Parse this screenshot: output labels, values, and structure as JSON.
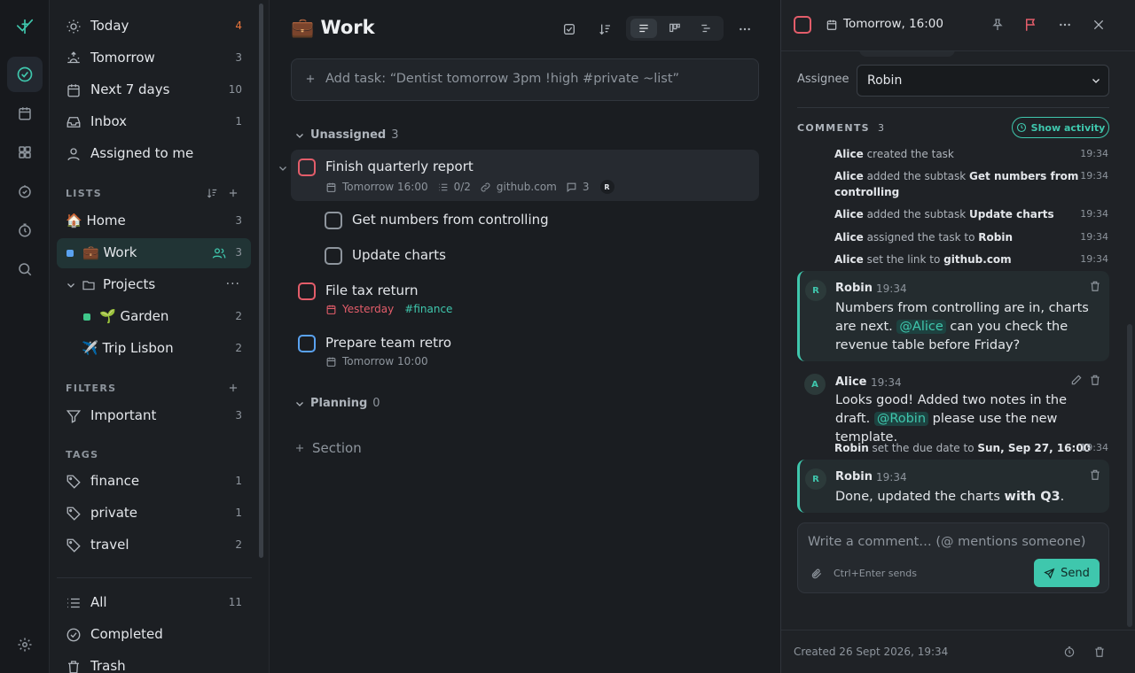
{
  "rail": {
    "items": [
      "check-circle-icon",
      "calendar-icon",
      "grid-icon",
      "compass-icon",
      "timer-icon",
      "search-icon",
      "settings-icon"
    ]
  },
  "sidebar": {
    "smart": [
      {
        "label": "Today",
        "count": "4",
        "icon": "sun-icon",
        "count_color": "#e8743b"
      },
      {
        "label": "Tomorrow",
        "count": "3",
        "icon": "sunrise-icon"
      },
      {
        "label": "Next 7 days",
        "count": "10",
        "icon": "calendar-icon"
      },
      {
        "label": "Inbox",
        "count": "1",
        "icon": "inbox-icon"
      },
      {
        "label": "Assigned to me",
        "count": "",
        "icon": "user-icon"
      }
    ],
    "lists_header": "LISTS",
    "lists": [
      {
        "label": "🏠 Home",
        "count": "3"
      },
      {
        "label": "💼 Work",
        "count": "3",
        "color": "#5aa2f0",
        "shared": true
      },
      {
        "label": "Projects",
        "count": ""
      },
      {
        "label": "🌱 Garden",
        "count": "2",
        "color": "#3fc78a"
      },
      {
        "label": "✈️ Trip Lisbon",
        "count": "2"
      }
    ],
    "filters_header": "FILTERS",
    "filters": [
      {
        "label": "Important",
        "count": "3"
      }
    ],
    "tags_header": "TAGS",
    "tags": [
      {
        "label": "finance",
        "count": "1"
      },
      {
        "label": "private",
        "count": "1"
      },
      {
        "label": "travel",
        "count": "2"
      }
    ],
    "bottom": [
      {
        "label": "All",
        "count": "11"
      },
      {
        "label": "Completed",
        "count": ""
      },
      {
        "label": "Trash",
        "count": ""
      }
    ]
  },
  "main": {
    "title": "💼 Work",
    "add_placeholder": "Add task: “Dentist tomorrow 3pm !high #private ~list”",
    "sections": [
      {
        "name": "Unassigned",
        "count": "3"
      },
      {
        "name": "Planning",
        "count": "0"
      }
    ],
    "add_section": "Section",
    "tasks": [
      {
        "title": "Finish quarterly report",
        "due": "Tomorrow 16:00",
        "subtasks": "0/2",
        "link": "github.com",
        "comments": "3",
        "assignee": "R",
        "priority": "high"
      },
      {
        "title": "Get numbers from controlling",
        "subtask": true
      },
      {
        "title": "Update charts",
        "subtask": true
      },
      {
        "title": "File tax return",
        "due": "Yesterday",
        "tag": "#finance",
        "priority": "high",
        "overdue": true
      },
      {
        "title": "Prepare team retro",
        "due": "Tomorrow 10:00",
        "priority": "medium"
      }
    ]
  },
  "detail": {
    "due": "Tomorrow, 16:00",
    "assignee_label": "Assignee",
    "assignee": "Robin",
    "comments_label": "COMMENTS",
    "comments_count": "3",
    "show_activity": "Show activity",
    "activity": [
      {
        "actor": "Alice",
        "text": " created the task",
        "time": "19:34"
      },
      {
        "actor": "Alice",
        "text": " added the subtask ",
        "obj": "Get numbers from controlling",
        "time": "19:34"
      },
      {
        "actor": "Alice",
        "text": " added the subtask ",
        "obj": "Update charts",
        "time": "19:34"
      },
      {
        "actor": "Alice",
        "text": " assigned the task to ",
        "obj": "Robin",
        "time": "19:34"
      },
      {
        "actor": "Alice",
        "text": " set the link to ",
        "obj": "github.com",
        "time": "19:34"
      }
    ],
    "comment1": {
      "author": "Robin",
      "avatar": "R",
      "time": "19:34",
      "pre": "Numbers from controlling are in, charts are next. ",
      "mention": "@Alice",
      "post": " can you check the revenue table before Friday?"
    },
    "comment2": {
      "author": "Alice",
      "avatar": "A",
      "time": "19:34",
      "pre": "Looks good! Added two notes in the draft. ",
      "mention": "@Robin",
      "post": " please use the new template."
    },
    "activity2": {
      "actor": "Robin",
      "text": " set the due date to ",
      "obj": "Sun, Sep 27, 16:00",
      "time": "19:34"
    },
    "comment3": {
      "author": "Robin",
      "avatar": "R",
      "time": "19:34",
      "pre": "Done, updated the charts ",
      "bold": "with Q3",
      "post": "."
    },
    "composer_placeholder": "Write a comment… (@ mentions someone)",
    "composer_hint": "Ctrl+Enter sends",
    "send": "Send",
    "created": "Created 26 Sept 2026, 19:34"
  },
  "colors": {
    "accent": "#3fc7ad",
    "priority_high": "#e35d6a",
    "priority_medium": "#5aa2f0",
    "overdue": "#e35d6a"
  }
}
